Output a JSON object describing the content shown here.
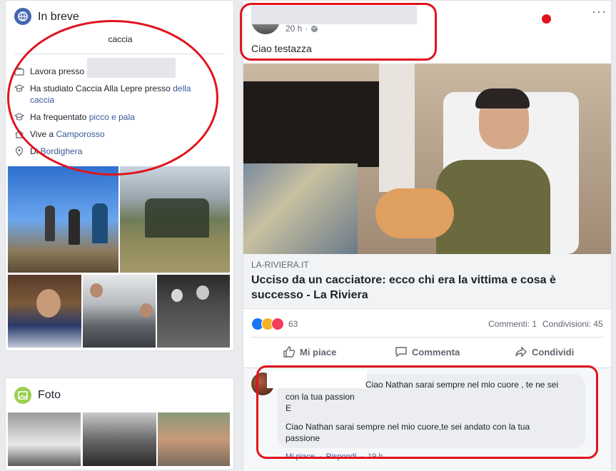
{
  "intro": {
    "title": "In breve",
    "bio": "caccia",
    "rows": [
      {
        "icon": "briefcase-icon",
        "text": "Lavora presso",
        "link": ""
      },
      {
        "icon": "graduation-cap-icon",
        "text": "Ha studiato Caccia Alla Lepre presso ",
        "link": "della caccia"
      },
      {
        "icon": "graduation-cap-icon",
        "text": "Ha frequentato ",
        "link": "picco e pala"
      },
      {
        "icon": "home-icon",
        "text": "Vive a ",
        "link": "Camporosso"
      },
      {
        "icon": "location-pin-icon",
        "text": "Di ",
        "link": "Bordighera"
      }
    ]
  },
  "photos": {
    "title": "Foto"
  },
  "post": {
    "time": "20 h",
    "separator": "·",
    "text": "Ciao testazza",
    "link_source": "LA-RIVIERA.IT",
    "link_title": "Ucciso da un cacciatore: ecco chi era la vittima e cosa è successo - La Riviera",
    "reactions_count": "63",
    "comments": "Commenti: 1",
    "shares": "Condivisioni: 45",
    "actions": {
      "like": "Mi piace",
      "comment": "Commenta",
      "share": "Condividi"
    },
    "more": "···"
  },
  "comment": {
    "text_line1": "Ciao Nathan sarai sempre nel mio cuore , te ne sei",
    "text_line2": "con la tua passion",
    "text_line3": "E",
    "text_line4": "Ciao Nathan sarai sempre nel mio cuore,te sei andato con la tua",
    "text_line5": "passione",
    "meta_like": "Mi piace",
    "meta_reply": "Rispondi",
    "meta_time": "19 h"
  },
  "colors": {
    "accent": "#385898",
    "annotation": "#e0141e",
    "bg": "#e9ebee"
  }
}
